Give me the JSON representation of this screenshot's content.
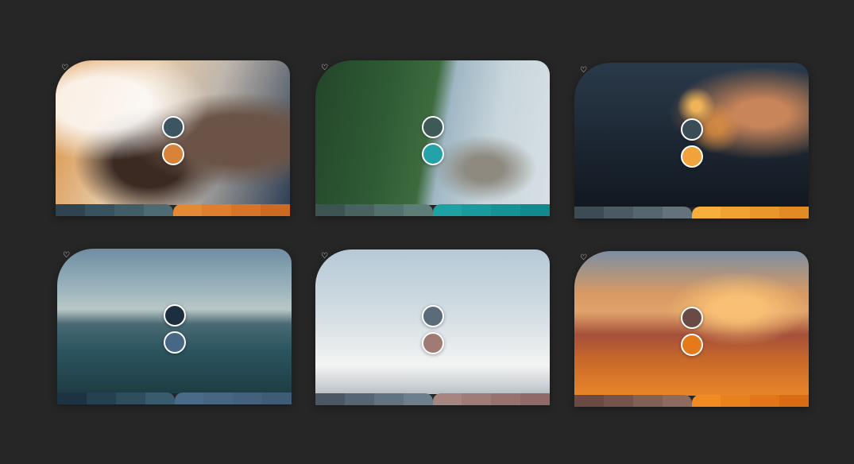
{
  "page": {
    "background_color": "#262626"
  },
  "cards": [
    {
      "name": "card-friends",
      "favorite_icon": "heart-outline-icon",
      "swatch_top": "#3d5560",
      "swatch_bottom": "#d9823a",
      "palette_left": [
        "#2f4450",
        "#385260",
        "#415d68",
        "#4e6a73"
      ],
      "palette_right": [
        "#e58a34",
        "#df7f2e",
        "#d77427",
        "#cc6a22"
      ]
    },
    {
      "name": "card-coast",
      "favorite_icon": "heart-outline-icon",
      "swatch_top": "#3e5a57",
      "swatch_bottom": "#23a3a8",
      "palette_left": [
        "#3d5552",
        "#476260",
        "#52706c",
        "#5e7d77"
      ],
      "palette_right": [
        "#1fa0a2",
        "#199a9c",
        "#159295",
        "#118a8e"
      ]
    },
    {
      "name": "card-sparkler",
      "favorite_icon": "heart-outline-icon",
      "swatch_top": "#3a4c55",
      "swatch_bottom": "#f2a23a",
      "palette_left": [
        "#3d4b54",
        "#4a5962",
        "#566670",
        "#63727c"
      ],
      "palette_right": [
        "#f6ae3c",
        "#f0a233",
        "#e9962b",
        "#e28a24"
      ]
    },
    {
      "name": "card-lake",
      "favorite_icon": "heart-outline-icon",
      "swatch_top": "#1d2f3f",
      "swatch_bottom": "#466884",
      "palette_left": [
        "#1d3341",
        "#254050",
        "#2e4e5e",
        "#385c6b"
      ],
      "palette_right": [
        "#4a6b87",
        "#476682",
        "#43617c",
        "#3f5c76"
      ]
    },
    {
      "name": "card-clouds",
      "favorite_icon": "heart-outline-icon",
      "swatch_top": "#5a6b7a",
      "swatch_bottom": "#a07b74",
      "palette_left": [
        "#4a5866",
        "#566573",
        "#617280",
        "#6d7f8c"
      ],
      "palette_right": [
        "#a88680",
        "#a07c77",
        "#98736e",
        "#906a66"
      ]
    },
    {
      "name": "card-sunset",
      "favorite_icon": "heart-outline-icon",
      "swatch_top": "#6a4a44",
      "swatch_bottom": "#e57a1a",
      "palette_left": [
        "#6a4a43",
        "#76544b",
        "#826054",
        "#8e6b5e"
      ],
      "palette_right": [
        "#f18b22",
        "#e9811d",
        "#e07618",
        "#d86c14"
      ]
    }
  ]
}
